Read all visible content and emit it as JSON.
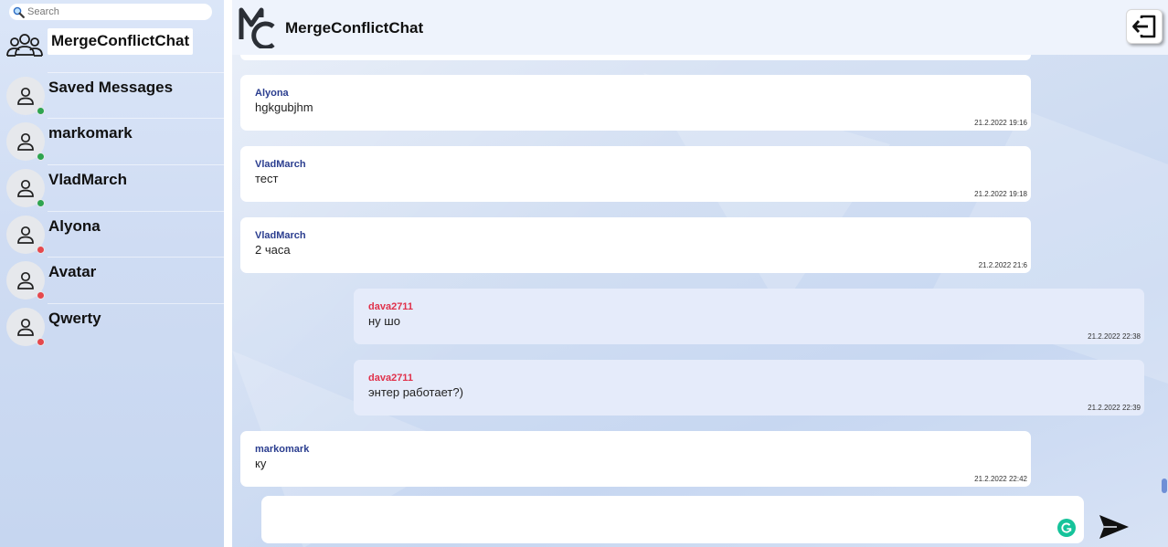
{
  "search": {
    "placeholder": "Search"
  },
  "sidebar": {
    "chats": [
      {
        "name": "MergeConflictChat",
        "type": "group",
        "icon": "group-icon"
      },
      {
        "name": "Saved Messages",
        "status": "online",
        "icon": "user-icon"
      },
      {
        "name": "markomark",
        "status": "online",
        "icon": "user-icon"
      },
      {
        "name": "VladMarch",
        "status": "online",
        "icon": "user-icon"
      },
      {
        "name": "Alyona",
        "status": "offline",
        "icon": "user-icon"
      },
      {
        "name": "Avatar",
        "status": "offline",
        "icon": "user-icon"
      },
      {
        "name": "Qwerty",
        "status": "offline",
        "icon": "user-icon"
      }
    ]
  },
  "header": {
    "title": "MergeConflictChat",
    "logo": "mc-logo",
    "logout_icon": "logout-icon"
  },
  "messages": [
    {
      "author": "Alyona",
      "text": "hgkgubjhm",
      "time": "21.2.2022 19:16",
      "own": false
    },
    {
      "author": "VladMarch",
      "text": "тест",
      "time": "21.2.2022 19:18",
      "own": false
    },
    {
      "author": "VladMarch",
      "text": "2 часа",
      "time": "21.2.2022 21:6",
      "own": false
    },
    {
      "author": "dava2711",
      "text": "ну шо",
      "time": "21.2.2022 22:38",
      "own": true
    },
    {
      "author": "dava2711",
      "text": "энтер работает?)",
      "time": "21.2.2022 22:39",
      "own": true
    },
    {
      "author": "markomark",
      "text": "ку",
      "time": "21.2.2022 22:42",
      "own": false
    }
  ],
  "composer": {
    "value": "",
    "send_icon": "send-icon",
    "extension_icon": "grammarly-icon"
  },
  "colors": {
    "own_author": "#e0314b",
    "other_author": "#2a3d8f",
    "online": "#2ea44f",
    "offline": "#e5484d"
  }
}
